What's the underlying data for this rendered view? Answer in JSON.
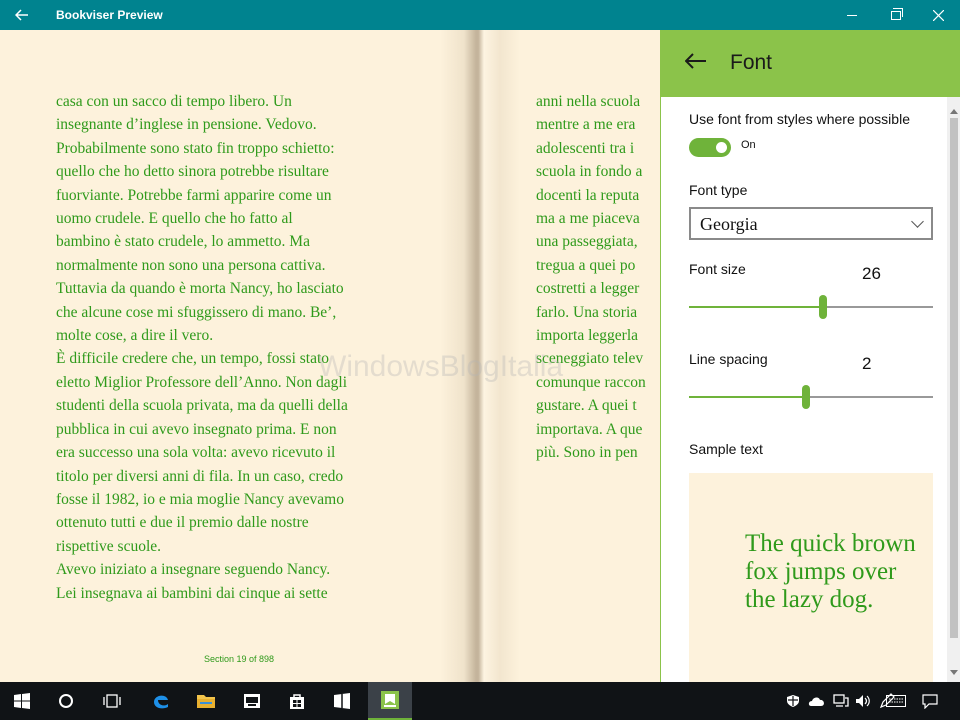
{
  "window": {
    "title": "Bookviser Preview",
    "back_icon": "back-arrow-icon",
    "controls": [
      "minimize-icon",
      "maximize-icon",
      "close-icon"
    ]
  },
  "book": {
    "left_page_lines": [
      "casa con un sacco di tempo libero. Un",
      "insegnante d’inglese in pensione. Vedovo.",
      "Probabilmente sono stato fin troppo schietto:",
      "quello che ho detto sinora potrebbe risultare",
      "fuorviante. Potrebbe farmi apparire come un",
      "uomo crudele. E quello che ho fatto al",
      "bambino è stato crudele, lo ammetto. Ma",
      "normalmente non sono una persona cattiva.",
      "Tuttavia da quando è morta Nancy, ho lasciato",
      "che alcune cose mi sfuggissero di mano. Be’,",
      "molte cose, a dire il vero.",
      "   È difficile credere che, un tempo, fossi stato",
      "eletto Miglior Professore dell’Anno. Non dagli",
      "studenti della scuola privata, ma da quelli della",
      "pubblica in cui avevo insegnato prima. E non",
      "era successo una sola volta: avevo ricevuto il",
      "titolo per diversi anni di fila. In un caso, credo",
      "fosse il 1982, io e mia moglie Nancy avevamo",
      "ottenuto tutti e due il premio dalle nostre",
      "rispettive scuole.",
      "   Avevo iniziato a insegnare seguendo Nancy.",
      "Lei insegnava ai bambini dai cinque ai sette"
    ],
    "right_page_lines": [
      "anni nella scuola",
      "mentre a me era",
      "adolescenti tra i",
      "scuola in fondo a",
      "docenti la reputa",
      "ma a me piaceva",
      "una passeggiata,",
      "tregua a quei po",
      "costretti a legger",
      "farlo. Una storia",
      "importa leggerla",
      "sceneggiato telev",
      "comunque raccon",
      "gustare. A quei t",
      "importava. A que",
      "più. Sono in pen"
    ],
    "section_label": "Section 19 of 898",
    "watermark": "WindowsBlogItalia"
  },
  "panel": {
    "title": "Font",
    "back_icon": "back-arrow-icon",
    "use_styles_label": "Use font from styles where possible",
    "toggle_state": "On",
    "toggle_on": true,
    "font_type_label": "Font type",
    "font_type_value": "Georgia",
    "font_size_label": "Font size",
    "font_size_value": "26",
    "font_size_fraction": 0.55,
    "line_spacing_label": "Line spacing",
    "line_spacing_value": "2",
    "line_spacing_fraction": 0.48,
    "sample_label": "Sample text",
    "sample_text": "The quick brown fox jumps over the lazy dog."
  },
  "colors": {
    "titlebar": "#00838f",
    "accent": "#8bc34a",
    "text_green": "#2f9a1b",
    "page_bg": "#fdf2dc",
    "taskbar": "#101316"
  },
  "taskbar": {
    "apps": [
      "windows-start-icon",
      "cortana-icon",
      "task-view-icon",
      "edge-icon",
      "file-explorer-icon",
      "store-icon",
      "windows-store-bag-icon",
      "app-icon",
      "bookviser-icon"
    ],
    "tray": [
      "defender-icon",
      "onedrive-icon",
      "network-icon",
      "volume-icon",
      "pen-icon",
      "keyboard-icon",
      "action-center-icon"
    ]
  }
}
